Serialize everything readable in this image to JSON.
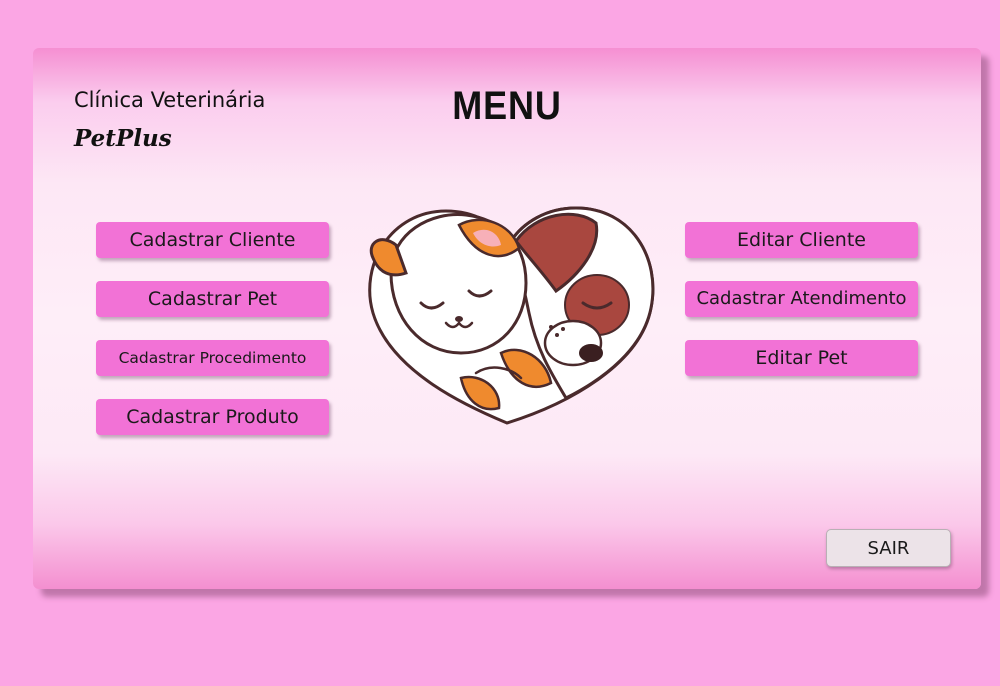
{
  "brand": {
    "line1": "Clínica Veterinária",
    "line2": "PetPlus"
  },
  "title": "MENU",
  "left_buttons": [
    {
      "label": "Cadastrar Cliente"
    },
    {
      "label": "Cadastrar Pet"
    },
    {
      "label": "Cadastrar Procedimento"
    },
    {
      "label": "Cadastrar Produto"
    }
  ],
  "right_buttons": [
    {
      "label": "Editar Cliente"
    },
    {
      "label": "Cadastrar Atendimento"
    },
    {
      "label": "Editar Pet"
    }
  ],
  "exit_label": "SAIR",
  "illustration": {
    "icon": "sleeping-cat-dog-heart-icon"
  },
  "colors": {
    "background": "#fba6e4",
    "button": "#f272d6",
    "exit_button": "#ece3e8",
    "cat_orange": "#ef8a2e",
    "dog_brown": "#a9473f",
    "outline": "#4a2a2c"
  }
}
